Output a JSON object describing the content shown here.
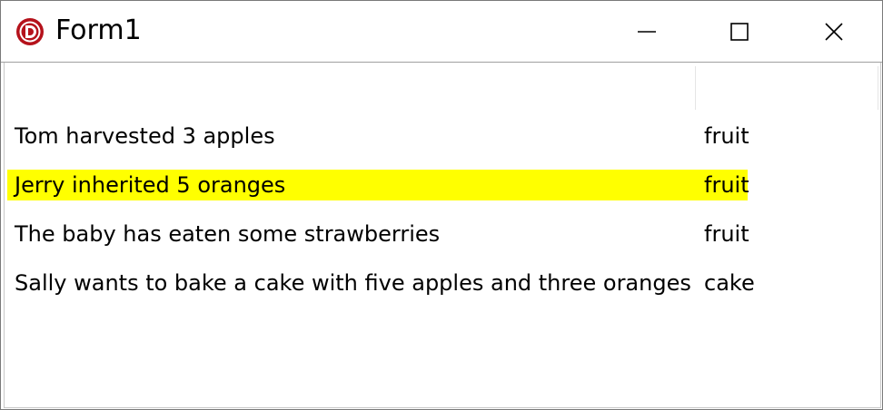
{
  "window": {
    "title": "Form1",
    "icon": "delphi-app-icon",
    "controls": {
      "minimize": "minimize-icon",
      "maximize": "maximize-icon",
      "close": "close-icon"
    }
  },
  "listview": {
    "columns": [
      "",
      ""
    ],
    "rows": [
      {
        "text": "Tom harvested 3 apples",
        "category": "fruit",
        "highlighted": false
      },
      {
        "text": "Jerry inherited 5 oranges",
        "category": "fruit",
        "highlighted": true
      },
      {
        "text": "The baby has eaten some strawberries",
        "category": "fruit",
        "highlighted": false
      },
      {
        "text": "Sally wants to bake a cake with five apples and three oranges",
        "category": "cake",
        "highlighted": false
      }
    ]
  },
  "colors": {
    "highlight": "#ffff00",
    "icon_red": "#b5121b"
  }
}
